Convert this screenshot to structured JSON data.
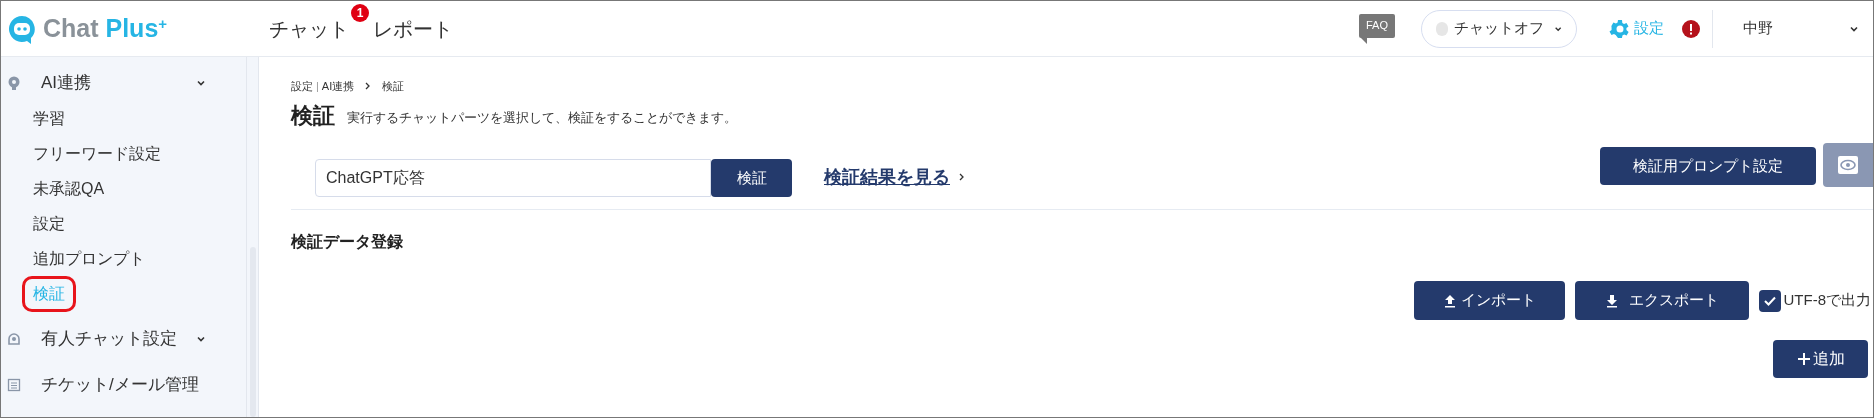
{
  "header": {
    "logo": {
      "text": "Chat",
      "accent": "Plus",
      "sup": "+"
    },
    "nav": [
      {
        "label": "チャット",
        "badge": "1"
      },
      {
        "label": "レポート"
      }
    ],
    "faq": "FAQ",
    "chat_status": {
      "label": "チャットオフ",
      "on": false
    },
    "settings": "設定",
    "user": "中野"
  },
  "sidebar": {
    "items": [
      {
        "label": "AI連携",
        "kind": "group",
        "children": [
          {
            "label": "学習",
            "selected": false
          },
          {
            "label": "フリーワード設定",
            "selected": false
          },
          {
            "label": "未承認QA",
            "selected": false
          },
          {
            "label": "設定",
            "selected": false
          },
          {
            "label": "追加プロンプト",
            "selected": false
          },
          {
            "label": "検証",
            "selected": true
          }
        ]
      },
      {
        "label": "有人チャット設定",
        "kind": "group"
      },
      {
        "label": "チケット/メール管理",
        "kind": "link"
      }
    ]
  },
  "breadcrumb": {
    "items": [
      "設定",
      "AI連携",
      "検証"
    ],
    "separator": "|"
  },
  "page": {
    "title": "検証",
    "description": "実行するチャットパーツを選択して、検証をすることができます。"
  },
  "verify": {
    "select_value": "ChatGPT応答",
    "button": "検証",
    "link": "検証結果を見る",
    "prompt_button": "検証用プロンプト設定"
  },
  "section": {
    "title": "検証データ登録",
    "import": "インポート",
    "export": "エクスポート",
    "utf8": {
      "label": "UTF-8で出力",
      "checked": true
    },
    "add": "追加"
  }
}
